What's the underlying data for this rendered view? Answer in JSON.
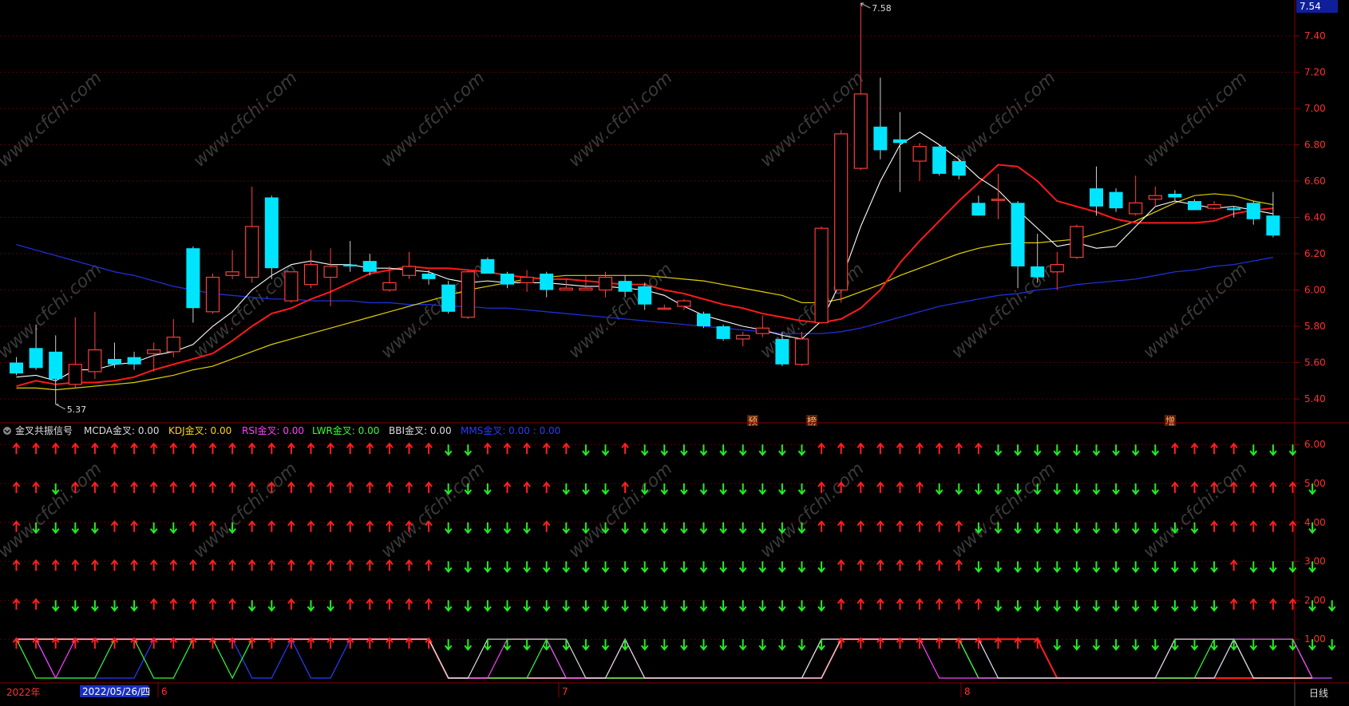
{
  "price_panel": {
    "axis_labels": [
      "7.40",
      "7.20",
      "7.00",
      "6.80",
      "6.60",
      "6.40",
      "6.20",
      "6.00",
      "5.80",
      "5.60",
      "5.40"
    ],
    "current_price_tag": "7.54",
    "high_label": "7.58",
    "low_label": "5.37",
    "event_markers": [
      "预",
      "榜",
      "增"
    ],
    "watermark": "www.cfchi.com",
    "colors": {
      "up": "#ff3b3b",
      "down": "#00e5ff",
      "ma5": "#ffffff",
      "ma10": "#ff1a1a",
      "ma20": "#e0d000",
      "ma60": "#1f2fd6",
      "grid": "#5a0000"
    }
  },
  "indicator_panel": {
    "title": "金叉共振信号",
    "legend": [
      {
        "label": "MCDA金叉: 0.00",
        "color": "#dddddd"
      },
      {
        "label": "KDJ金叉: 0.00",
        "color": "#ffd700"
      },
      {
        "label": "RSI金叉: 0.00",
        "color": "#ff40ff"
      },
      {
        "label": "LWR金叉: 0.00",
        "color": "#33ff33"
      },
      {
        "label": "BBI金叉: 0.00",
        "color": "#dddddd"
      },
      {
        "label": "MMS金叉: 0.00 : 0.00",
        "color": "#2a3cff"
      }
    ],
    "axis_labels": [
      "6.00",
      "5.00",
      "4.00",
      "3.00",
      "2.00",
      "1.00"
    ]
  },
  "status_bar": {
    "year": "2022年",
    "date_cursor": "2022/05/26/四",
    "month_labels": [
      "6",
      "7",
      "8"
    ],
    "period_button": "日线"
  },
  "chart_data": {
    "type": "candlestick",
    "y_range": [
      5.3,
      7.6
    ],
    "candles": [
      {
        "o": 5.6,
        "h": 5.63,
        "l": 5.53,
        "c": 5.54
      },
      {
        "o": 5.68,
        "h": 5.81,
        "l": 5.56,
        "c": 5.57
      },
      {
        "o": 5.66,
        "h": 5.75,
        "l": 5.37,
        "c": 5.51
      },
      {
        "o": 5.48,
        "h": 5.85,
        "l": 5.46,
        "c": 5.59
      },
      {
        "o": 5.55,
        "h": 5.88,
        "l": 5.51,
        "c": 5.67
      },
      {
        "o": 5.62,
        "h": 5.71,
        "l": 5.57,
        "c": 5.59
      },
      {
        "o": 5.63,
        "h": 5.66,
        "l": 5.56,
        "c": 5.59
      },
      {
        "o": 5.65,
        "h": 5.71,
        "l": 5.55,
        "c": 5.67
      },
      {
        "o": 5.66,
        "h": 5.84,
        "l": 5.63,
        "c": 5.74
      },
      {
        "o": 6.23,
        "h": 6.24,
        "l": 5.82,
        "c": 5.9
      },
      {
        "o": 5.88,
        "h": 6.09,
        "l": 5.87,
        "c": 6.07
      },
      {
        "o": 6.08,
        "h": 6.22,
        "l": 6.06,
        "c": 6.1
      },
      {
        "o": 6.07,
        "h": 6.57,
        "l": 6.04,
        "c": 6.35
      },
      {
        "o": 6.51,
        "h": 6.52,
        "l": 6.06,
        "c": 6.12
      },
      {
        "o": 5.94,
        "h": 6.09,
        "l": 5.93,
        "c": 6.1
      },
      {
        "o": 6.03,
        "h": 6.22,
        "l": 6.01,
        "c": 6.14
      },
      {
        "o": 6.07,
        "h": 6.23,
        "l": 5.91,
        "c": 6.13
      },
      {
        "o": 6.14,
        "h": 6.27,
        "l": 6.1,
        "c": 6.13
      },
      {
        "o": 6.16,
        "h": 6.2,
        "l": 6.08,
        "c": 6.1
      },
      {
        "o": 6.0,
        "h": 6.13,
        "l": 5.99,
        "c": 6.04
      },
      {
        "o": 6.08,
        "h": 6.21,
        "l": 6.06,
        "c": 6.13
      },
      {
        "o": 6.09,
        "h": 6.11,
        "l": 6.03,
        "c": 6.06
      },
      {
        "o": 6.03,
        "h": 6.05,
        "l": 5.87,
        "c": 5.88
      },
      {
        "o": 5.85,
        "h": 6.11,
        "l": 5.84,
        "c": 6.1
      },
      {
        "o": 6.17,
        "h": 6.18,
        "l": 6.09,
        "c": 6.09
      },
      {
        "o": 6.09,
        "h": 6.1,
        "l": 6.01,
        "c": 6.03
      },
      {
        "o": 6.04,
        "h": 6.11,
        "l": 5.99,
        "c": 6.07
      },
      {
        "o": 6.09,
        "h": 6.1,
        "l": 5.96,
        "c": 6.0
      },
      {
        "o": 6.0,
        "h": 6.06,
        "l": 6.0,
        "c": 6.01
      },
      {
        "o": 6.0,
        "h": 6.08,
        "l": 6.0,
        "c": 6.01
      },
      {
        "o": 6.0,
        "h": 6.1,
        "l": 5.96,
        "c": 6.07
      },
      {
        "o": 6.05,
        "h": 6.08,
        "l": 5.96,
        "c": 5.99
      },
      {
        "o": 6.02,
        "h": 6.04,
        "l": 5.89,
        "c": 5.92
      },
      {
        "o": 5.9,
        "h": 5.92,
        "l": 5.89,
        "c": 5.9
      },
      {
        "o": 5.91,
        "h": 5.95,
        "l": 5.89,
        "c": 5.94
      },
      {
        "o": 5.87,
        "h": 5.88,
        "l": 5.79,
        "c": 5.8
      },
      {
        "o": 5.8,
        "h": 5.81,
        "l": 5.72,
        "c": 5.73
      },
      {
        "o": 5.73,
        "h": 5.77,
        "l": 5.69,
        "c": 5.75
      },
      {
        "o": 5.76,
        "h": 5.86,
        "l": 5.74,
        "c": 5.79
      },
      {
        "o": 5.73,
        "h": 5.77,
        "l": 5.58,
        "c": 5.59
      },
      {
        "o": 5.59,
        "h": 5.77,
        "l": 5.58,
        "c": 5.73
      },
      {
        "o": 5.82,
        "h": 6.35,
        "l": 5.82,
        "c": 6.34
      },
      {
        "o": 6.0,
        "h": 6.88,
        "l": 5.93,
        "c": 6.86
      },
      {
        "o": 6.67,
        "h": 7.58,
        "l": 6.66,
        "c": 7.08
      },
      {
        "o": 6.9,
        "h": 7.17,
        "l": 6.72,
        "c": 6.77
      },
      {
        "o": 6.83,
        "h": 6.98,
        "l": 6.54,
        "c": 6.81
      },
      {
        "o": 6.71,
        "h": 6.81,
        "l": 6.6,
        "c": 6.79
      },
      {
        "o": 6.79,
        "h": 6.8,
        "l": 6.63,
        "c": 6.64
      },
      {
        "o": 6.71,
        "h": 6.72,
        "l": 6.61,
        "c": 6.63
      },
      {
        "o": 6.48,
        "h": 6.52,
        "l": 6.41,
        "c": 6.41
      },
      {
        "o": 6.5,
        "h": 6.64,
        "l": 6.39,
        "c": 6.5
      },
      {
        "o": 6.48,
        "h": 6.49,
        "l": 6.01,
        "c": 6.13
      },
      {
        "o": 6.13,
        "h": 6.31,
        "l": 6.04,
        "c": 6.07
      },
      {
        "o": 6.1,
        "h": 6.21,
        "l": 6.0,
        "c": 6.14
      },
      {
        "o": 6.18,
        "h": 6.36,
        "l": 6.17,
        "c": 6.35
      },
      {
        "o": 6.56,
        "h": 6.68,
        "l": 6.41,
        "c": 6.46
      },
      {
        "o": 6.54,
        "h": 6.56,
        "l": 6.43,
        "c": 6.45
      },
      {
        "o": 6.42,
        "h": 6.63,
        "l": 6.41,
        "c": 6.48
      },
      {
        "o": 6.5,
        "h": 6.57,
        "l": 6.46,
        "c": 6.52
      },
      {
        "o": 6.53,
        "h": 6.55,
        "l": 6.49,
        "c": 6.51
      },
      {
        "o": 6.49,
        "h": 6.5,
        "l": 6.44,
        "c": 6.44
      },
      {
        "o": 6.45,
        "h": 6.49,
        "l": 6.44,
        "c": 6.47
      },
      {
        "o": 6.45,
        "h": 6.46,
        "l": 6.4,
        "c": 6.44
      },
      {
        "o": 6.48,
        "h": 6.49,
        "l": 6.36,
        "c": 6.39
      },
      {
        "o": 6.41,
        "h": 6.54,
        "l": 6.29,
        "c": 6.3
      }
    ],
    "ma5": [
      5.52,
      5.53,
      5.5,
      5.56,
      5.56,
      5.59,
      5.6,
      5.64,
      5.66,
      5.7,
      5.8,
      5.88,
      6.0,
      6.08,
      6.14,
      6.16,
      6.14,
      6.14,
      6.12,
      6.12,
      6.11,
      6.1,
      6.06,
      6.04,
      6.05,
      6.04,
      6.04,
      6.04,
      6.03,
      6.02,
      6.02,
      6.01,
      6.0,
      5.97,
      5.91,
      5.86,
      5.83,
      5.8,
      5.78,
      5.75,
      5.73,
      5.83,
      6.05,
      6.35,
      6.6,
      6.8,
      6.87,
      6.8,
      6.72,
      6.62,
      6.55,
      6.44,
      6.34,
      6.24,
      6.26,
      6.23,
      6.24,
      6.35,
      6.46,
      6.49,
      6.47,
      6.45,
      6.46,
      6.44,
      6.42
    ],
    "ma10": [
      5.47,
      5.5,
      5.48,
      5.49,
      5.49,
      5.5,
      5.52,
      5.56,
      5.59,
      5.62,
      5.65,
      5.72,
      5.8,
      5.87,
      5.9,
      5.95,
      5.99,
      6.04,
      6.09,
      6.11,
      6.13,
      6.12,
      6.12,
      6.11,
      6.1,
      6.08,
      6.07,
      6.06,
      6.06,
      6.05,
      6.04,
      6.03,
      6.03,
      6.0,
      5.98,
      5.95,
      5.92,
      5.9,
      5.87,
      5.85,
      5.83,
      5.82,
      5.84,
      5.9,
      6.0,
      6.15,
      6.27,
      6.38,
      6.49,
      6.59,
      6.69,
      6.68,
      6.6,
      6.49,
      6.46,
      6.43,
      6.39,
      6.37,
      6.37,
      6.37,
      6.37,
      6.38,
      6.42,
      6.44,
      6.45
    ],
    "ma20": [
      5.46,
      5.46,
      5.45,
      5.46,
      5.47,
      5.48,
      5.49,
      5.51,
      5.53,
      5.56,
      5.58,
      5.62,
      5.66,
      5.7,
      5.73,
      5.76,
      5.79,
      5.82,
      5.85,
      5.88,
      5.91,
      5.94,
      5.97,
      6.0,
      6.02,
      6.04,
      6.06,
      6.07,
      6.08,
      6.08,
      6.08,
      6.08,
      6.08,
      6.07,
      6.06,
      6.05,
      6.03,
      6.01,
      5.99,
      5.97,
      5.93,
      5.93,
      5.95,
      5.99,
      6.03,
      6.08,
      6.12,
      6.16,
      6.2,
      6.23,
      6.25,
      6.26,
      6.26,
      6.27,
      6.28,
      6.31,
      6.34,
      6.38,
      6.43,
      6.48,
      6.52,
      6.53,
      6.52,
      6.49,
      6.47
    ],
    "ma60": [
      6.25,
      6.22,
      6.19,
      6.16,
      6.13,
      6.1,
      6.08,
      6.05,
      6.02,
      6.0,
      5.98,
      5.97,
      5.96,
      5.95,
      5.95,
      5.94,
      5.94,
      5.94,
      5.93,
      5.93,
      5.92,
      5.92,
      5.91,
      5.91,
      5.9,
      5.9,
      5.89,
      5.88,
      5.87,
      5.86,
      5.85,
      5.84,
      5.83,
      5.82,
      5.81,
      5.8,
      5.79,
      5.78,
      5.77,
      5.76,
      5.76,
      5.76,
      5.77,
      5.79,
      5.82,
      5.85,
      5.88,
      5.91,
      5.93,
      5.95,
      5.97,
      5.98,
      6.0,
      6.01,
      6.03,
      6.04,
      6.05,
      6.06,
      6.08,
      6.1,
      6.11,
      6.13,
      6.14,
      6.16,
      6.18
    ],
    "signal_rows": [
      "UUUUUUUUUUUUUUUUUUUUUUDDUUUUUDDUDDDDDDDDDUUUUUUUUUDDDDDDDDDUUUUDDD",
      "UUDUUUUUUUUUUUUUUUUUUUDDDUUUDDDUDDDDDDDDDUUUUUUDDDDDDDDDDDDUUUUUUUD",
      "UDDDDUUDDUUDUUUUUUUUUUDDDDDUDDDDDDDDDDDDDUUUUUUUUDDDDDDDDDDDDUUUUUD",
      "UUUUUUUUUUUUUUUUUUUUUUDDDDDDDDDDDDDDDDDDDDUUUUUUUDDDDDDDDDDDDDUDDDD",
      "UUDDDDDUUUUUDDUDDUUUUUDDDDDDDDDDDDDDDDDDDDUUUUUUUUDDDDDDDDDDDDUUUUDD",
      "UUUUUUUUUUUUUUUUUUUUUUDDDDDDDDDDDDDDDDDDDDUUUUUUUUUUUDDDDDDDDDDDDDDD"
    ]
  }
}
